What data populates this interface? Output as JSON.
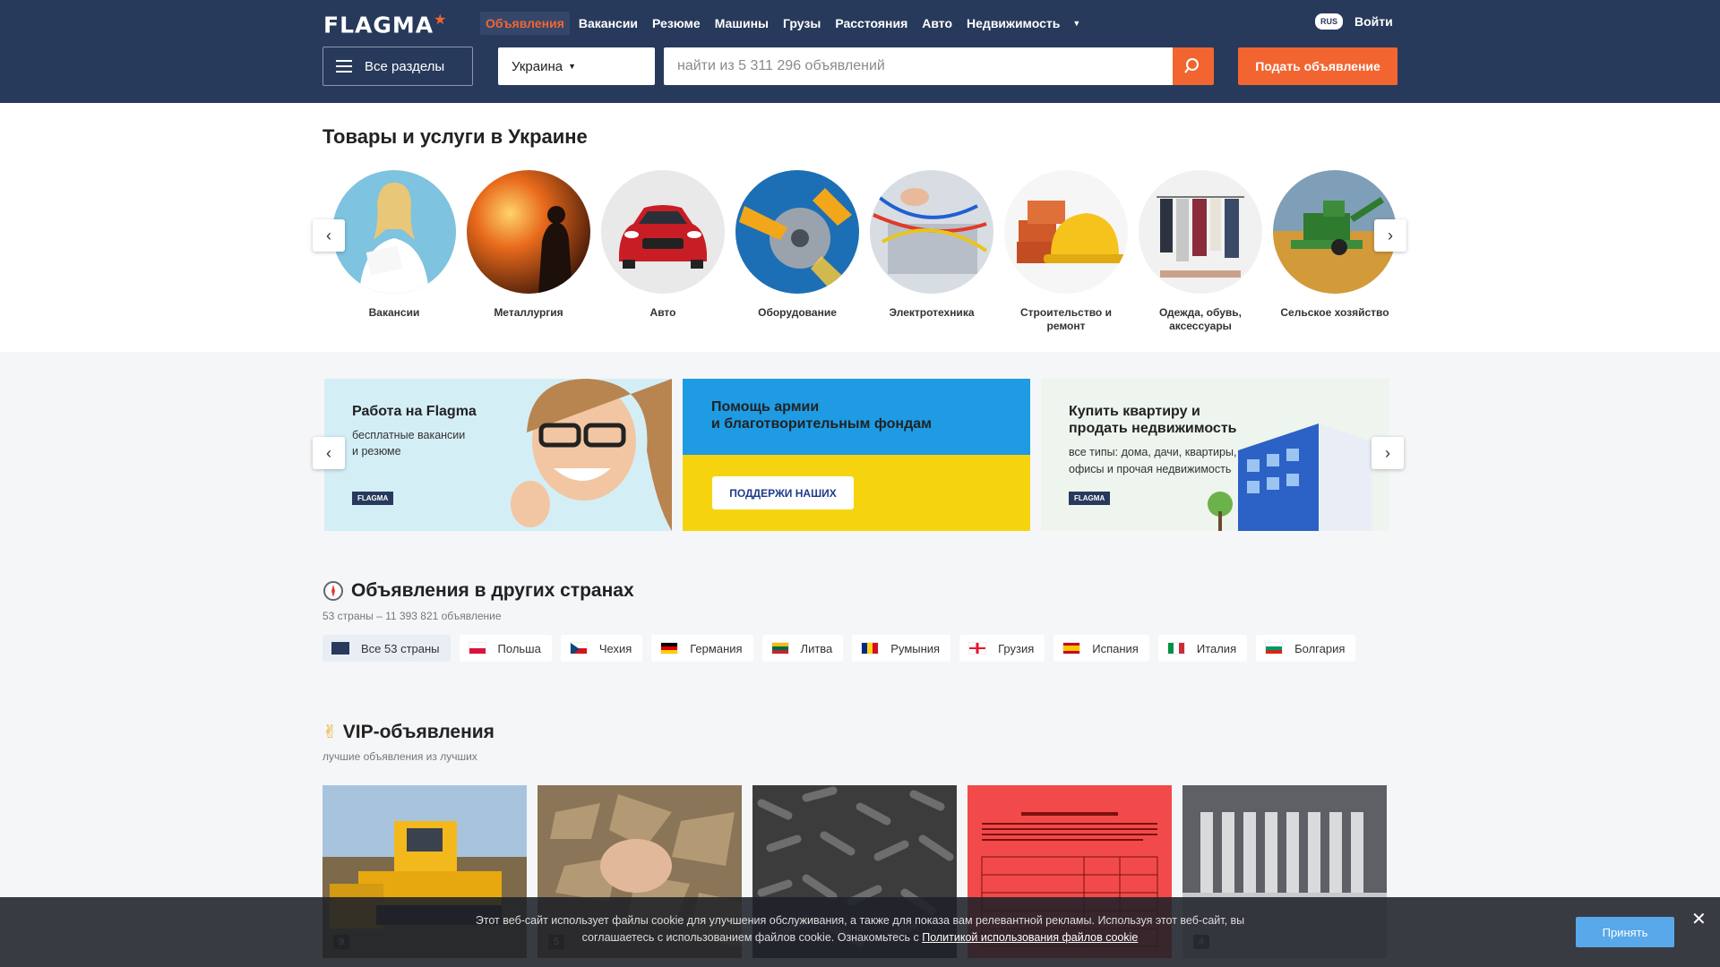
{
  "header": {
    "logo": "FLAGMA",
    "nav": [
      "Объявления",
      "Вакансии",
      "Резюме",
      "Машины",
      "Грузы",
      "Расстояния",
      "Авто",
      "Недвижимость"
    ],
    "lang": "RUS",
    "login": "Войти",
    "sections_label": "Все разделы",
    "country": "Украина",
    "search_placeholder": "найти из 5 311 296 объявлений",
    "post_label": "Подать объявление"
  },
  "categories": {
    "title": "Товары и услуги в Украине",
    "items": [
      {
        "label": "Вакансии",
        "icon": "woman-photo"
      },
      {
        "label": "Металлургия",
        "icon": "steel-worker-photo"
      },
      {
        "label": "Авто",
        "icon": "red-car-photo"
      },
      {
        "label": "Оборудование",
        "icon": "grinder-photo"
      },
      {
        "label": "Электротехника",
        "icon": "wires-photo"
      },
      {
        "label": "Строительство и ремонт",
        "icon": "helmet-bricks-photo"
      },
      {
        "label": "Одежда, обувь, аксессуары",
        "icon": "wardrobe-photo"
      },
      {
        "label": "Сельское хозяйство",
        "icon": "harvester-photo"
      }
    ]
  },
  "banners": {
    "work": {
      "title": "Работа на Flagma",
      "sub1": "бесплатные вакансии",
      "sub2": "и резюме",
      "logo": "FLAGMA"
    },
    "help": {
      "title1": "Помощь армии",
      "title2": "и благотворительным фондам",
      "button": "ПОДДЕРЖИ НАШИХ"
    },
    "realty": {
      "title1": "Купить квартиру и",
      "title2": "продать недвижимость",
      "sub1": "все типы: дома, дачи, квартиры,",
      "sub2": "офисы и прочая недвижимость",
      "logo": "FLAGMA"
    }
  },
  "countries": {
    "title": "Объявления в других странах",
    "subtitle": "53 страны – 11 393 821 объявление",
    "items": [
      "Все 53 страны",
      "Польша",
      "Чехия",
      "Германия",
      "Литва",
      "Румыния",
      "Грузия",
      "Испания",
      "Италия",
      "Болгария"
    ]
  },
  "vip": {
    "title": "VIP-объявления",
    "subtitle": "лучшие объявления из лучших",
    "cards": [
      {
        "photos": "9",
        "image": "bulldozer-photo"
      },
      {
        "photos": "5",
        "image": "wood-chips-photo"
      },
      {
        "photos": "",
        "image": "pellets-photo"
      },
      {
        "photos": "",
        "image": "price-list-photo"
      },
      {
        "photos": "4",
        "image": "concrete-blocks-photo"
      }
    ]
  },
  "cookie": {
    "text1": "Этот веб-сайт использует файлы cookie для улучшения обслуживания, а также для показа вам релевантной рекламы. Используя этот веб-сайт, вы",
    "text2": "соглашаетесь с использованием файлов cookie. Ознакомьтесь с ",
    "link": "Политикой использования файлов cookie",
    "accept": "Принять",
    "close": "✕"
  },
  "colors": {
    "header": "#283a5b",
    "accent": "#f26531",
    "accept": "#58a8ea"
  }
}
